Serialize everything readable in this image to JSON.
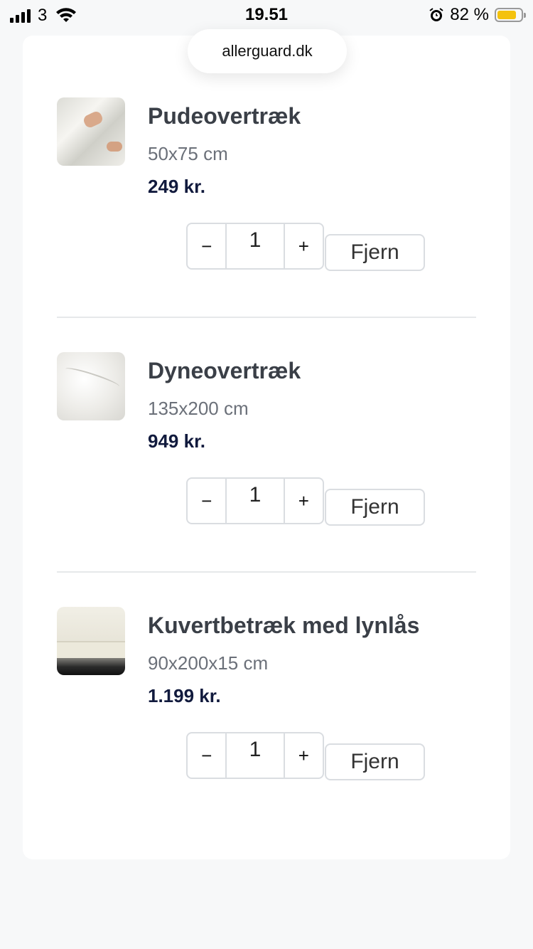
{
  "status_bar": {
    "carrier": "3",
    "time": "19.51",
    "battery_percent": "82 %",
    "battery_level": 0.82
  },
  "browser": {
    "url": "allerguard.dk"
  },
  "cart": {
    "items": [
      {
        "name": "Pudeovertræk",
        "size": "50x75 cm",
        "price": "249 kr.",
        "quantity": "1",
        "minus": "−",
        "plus": "+",
        "remove_label": "Fjern"
      },
      {
        "name": "Dyneovertræk",
        "size": "135x200 cm",
        "price": "949 kr.",
        "quantity": "1",
        "minus": "−",
        "plus": "+",
        "remove_label": "Fjern"
      },
      {
        "name": "Kuvertbetræk med lynlås",
        "size": "90x200x15 cm",
        "price": "1.199 kr.",
        "quantity": "1",
        "minus": "−",
        "plus": "+",
        "remove_label": "Fjern"
      }
    ]
  },
  "colors": {
    "price": "#111a3d",
    "battery": "#f4c20d",
    "page_bg": "#f7f8f9"
  }
}
